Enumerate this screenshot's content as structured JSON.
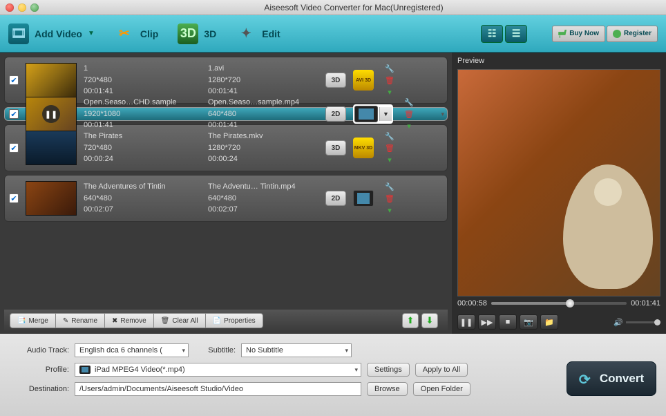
{
  "window": {
    "title": "Aiseesoft Video Converter for Mac(Unregistered)"
  },
  "toolbar": {
    "add_video": "Add Video",
    "clip": "Clip",
    "d3": "3D",
    "edit": "Edit",
    "buy_now": "Buy Now",
    "register": "Register"
  },
  "preview": {
    "label": "Preview",
    "current": "00:00:58",
    "total": "00:01:41"
  },
  "rows": [
    {
      "name": "1",
      "src_res": "720*480",
      "src_dur": "00:01:41",
      "out_name": "1.avi",
      "out_res": "1280*720",
      "out_dur": "00:01:41",
      "dim": "3D",
      "fmt": "AVI\n3D"
    },
    {
      "name": "Open.Seaso…CHD.sample",
      "src_res": "1920*1080",
      "src_dur": "00:01:41",
      "out_name": "Open.Seaso…sample.mp4",
      "out_res": "640*480",
      "out_dur": "00:01:41",
      "dim": "2D",
      "fmt": "iPad"
    },
    {
      "name": "The Pirates",
      "src_res": "720*480",
      "src_dur": "00:00:24",
      "out_name": "The Pirates.mkv",
      "out_res": "1280*720",
      "out_dur": "00:00:24",
      "dim": "3D",
      "fmt": "MKV\n3D"
    },
    {
      "name": "The Adventures of Tintin",
      "src_res": "640*480",
      "src_dur": "00:02:07",
      "out_name": "The Adventu… Tintin.mp4",
      "out_res": "640*480",
      "out_dur": "00:02:07",
      "dim": "2D",
      "fmt": "iPad"
    }
  ],
  "actions": {
    "merge": "Merge",
    "rename": "Rename",
    "remove": "Remove",
    "clear": "Clear All",
    "properties": "Properties"
  },
  "bottom": {
    "audio_label": "Audio Track:",
    "audio_value": "English dca 6 channels (",
    "subtitle_label": "Subtitle:",
    "subtitle_value": "No Subtitle",
    "profile_label": "Profile:",
    "profile_value": "iPad MPEG4 Video(*.mp4)",
    "dest_label": "Destination:",
    "dest_value": "/Users/admin/Documents/Aiseesoft Studio/Video",
    "settings": "Settings",
    "apply_all": "Apply to All",
    "browse": "Browse",
    "open_folder": "Open Folder",
    "convert": "Convert"
  }
}
